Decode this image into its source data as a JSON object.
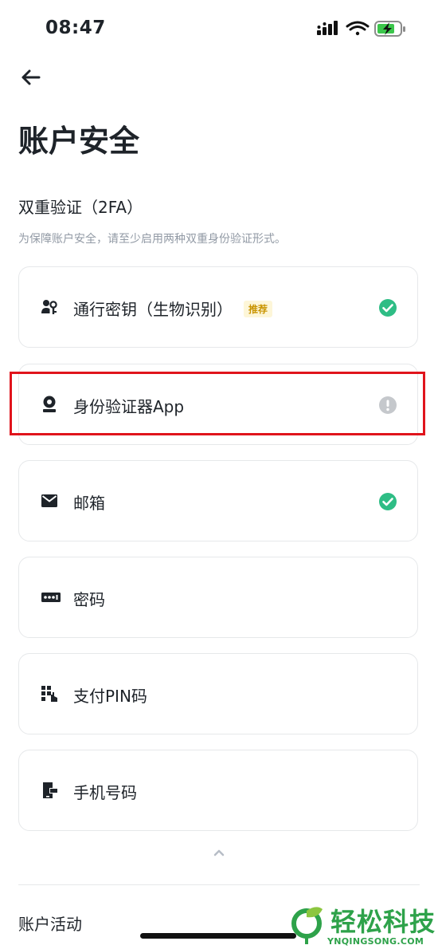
{
  "status_bar": {
    "time": "08:47"
  },
  "header": {
    "title": "账户安全"
  },
  "twofa": {
    "title": "双重验证（2FA）",
    "description": "为保障账户安全，请至少启用两种双重身份验证形式。"
  },
  "methods": [
    {
      "label": "通行密钥（生物识别）",
      "badge": "推荐",
      "icon": "passkey-icon",
      "status": "verified"
    },
    {
      "label": "身份验证器App",
      "icon": "authenticator-icon",
      "status": "warning"
    },
    {
      "label": "邮箱",
      "icon": "mail-icon",
      "status": "verified"
    },
    {
      "label": "密码",
      "icon": "password-icon",
      "status": "none"
    },
    {
      "label": "支付PIN码",
      "icon": "pin-keypad-icon",
      "status": "none"
    },
    {
      "label": "手机号码",
      "icon": "phone-icon",
      "status": "none"
    }
  ],
  "activity": {
    "title": "账户活动"
  },
  "watermark": {
    "text": "轻松科技",
    "subtext": "YNQINGSONG.COM"
  },
  "colors": {
    "verified": "#2ebd85",
    "warning": "#c5c8cc",
    "highlight": "#e0141c",
    "badge": "#c99400"
  }
}
